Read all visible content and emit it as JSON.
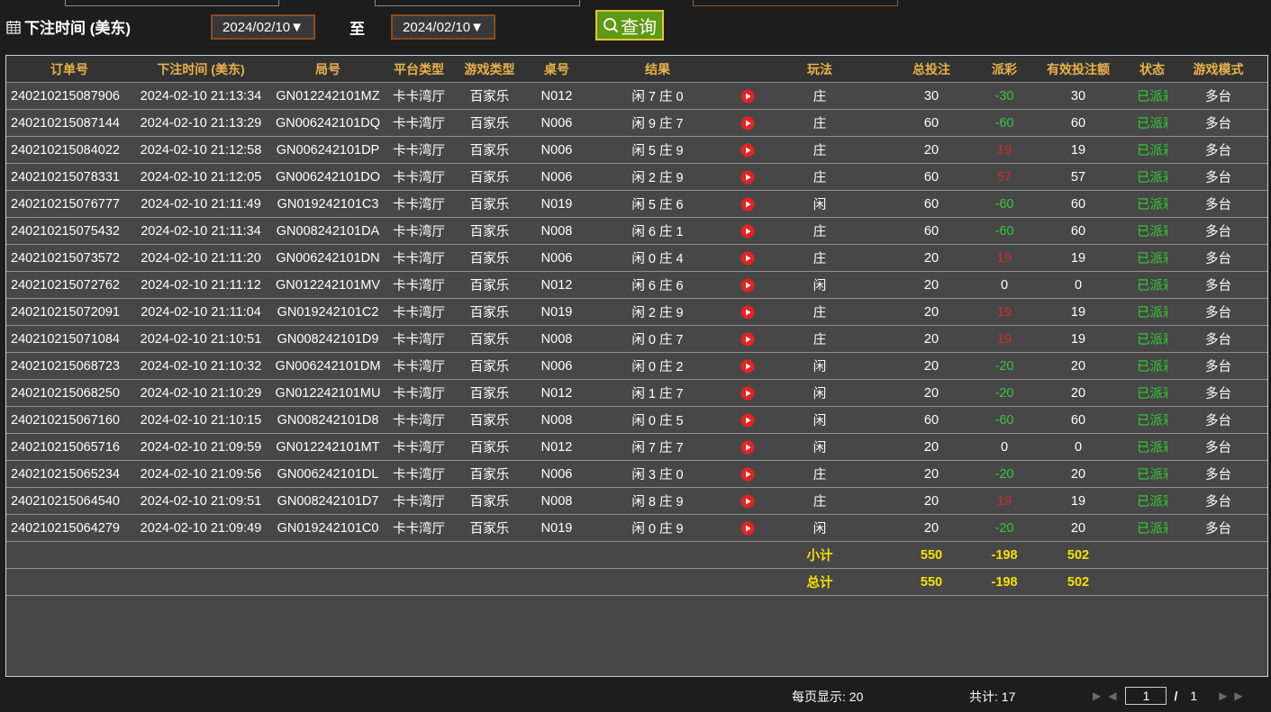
{
  "filter": {
    "date_label": "下注时间 (美东)",
    "start_date": "2024/02/10▼",
    "to_label": "至",
    "end_date": "2024/02/10▼",
    "query_label": "查询"
  },
  "table": {
    "headers": [
      "订单号",
      "下注时间 (美东)",
      "局号",
      "平台类型",
      "游戏类型",
      "桌号",
      "结果",
      "",
      "玩法",
      "总投注",
      "派彩",
      "有效投注额",
      "状态",
      "游戏模式"
    ],
    "rows": [
      {
        "order": "240210215087906",
        "time": "2024-02-10 21:13:34",
        "round": "GN012242101MZ",
        "platform": "卡卡湾厅",
        "game": "百家乐",
        "table": "N012",
        "result": "闲 7 庄 0",
        "play": "庄",
        "bet": "30",
        "payout": "-30",
        "payout_color": "green",
        "valid": "30",
        "status": "已派彩",
        "mode": "多台"
      },
      {
        "order": "240210215087144",
        "time": "2024-02-10 21:13:29",
        "round": "GN006242101DQ",
        "platform": "卡卡湾厅",
        "game": "百家乐",
        "table": "N006",
        "result": "闲 9 庄 7",
        "play": "庄",
        "bet": "60",
        "payout": "-60",
        "payout_color": "green",
        "valid": "60",
        "status": "已派彩",
        "mode": "多台"
      },
      {
        "order": "240210215084022",
        "time": "2024-02-10 21:12:58",
        "round": "GN006242101DP",
        "platform": "卡卡湾厅",
        "game": "百家乐",
        "table": "N006",
        "result": "闲 5 庄 9",
        "play": "庄",
        "bet": "20",
        "payout": "19",
        "payout_color": "red",
        "valid": "19",
        "status": "已派彩",
        "mode": "多台"
      },
      {
        "order": "240210215078331",
        "time": "2024-02-10 21:12:05",
        "round": "GN006242101DO",
        "platform": "卡卡湾厅",
        "game": "百家乐",
        "table": "N006",
        "result": "闲 2 庄 9",
        "play": "庄",
        "bet": "60",
        "payout": "57",
        "payout_color": "red",
        "valid": "57",
        "status": "已派彩",
        "mode": "多台"
      },
      {
        "order": "240210215076777",
        "time": "2024-02-10 21:11:49",
        "round": "GN019242101C3",
        "platform": "卡卡湾厅",
        "game": "百家乐",
        "table": "N019",
        "result": "闲 5 庄 6",
        "play": "闲",
        "bet": "60",
        "payout": "-60",
        "payout_color": "green",
        "valid": "60",
        "status": "已派彩",
        "mode": "多台"
      },
      {
        "order": "240210215075432",
        "time": "2024-02-10 21:11:34",
        "round": "GN008242101DA",
        "platform": "卡卡湾厅",
        "game": "百家乐",
        "table": "N008",
        "result": "闲 6 庄 1",
        "play": "庄",
        "bet": "60",
        "payout": "-60",
        "payout_color": "green",
        "valid": "60",
        "status": "已派彩",
        "mode": "多台"
      },
      {
        "order": "240210215073572",
        "time": "2024-02-10 21:11:20",
        "round": "GN006242101DN",
        "platform": "卡卡湾厅",
        "game": "百家乐",
        "table": "N006",
        "result": "闲 0 庄 4",
        "play": "庄",
        "bet": "20",
        "payout": "19",
        "payout_color": "red",
        "valid": "19",
        "status": "已派彩",
        "mode": "多台"
      },
      {
        "order": "240210215072762",
        "time": "2024-02-10 21:11:12",
        "round": "GN012242101MV",
        "platform": "卡卡湾厅",
        "game": "百家乐",
        "table": "N012",
        "result": "闲 6 庄 6",
        "play": "闲",
        "bet": "20",
        "payout": "0",
        "payout_color": "white",
        "valid": "0",
        "status": "已派彩",
        "mode": "多台"
      },
      {
        "order": "240210215072091",
        "time": "2024-02-10 21:11:04",
        "round": "GN019242101C2",
        "platform": "卡卡湾厅",
        "game": "百家乐",
        "table": "N019",
        "result": "闲 2 庄 9",
        "play": "庄",
        "bet": "20",
        "payout": "19",
        "payout_color": "red",
        "valid": "19",
        "status": "已派彩",
        "mode": "多台"
      },
      {
        "order": "240210215071084",
        "time": "2024-02-10 21:10:51",
        "round": "GN008242101D9",
        "platform": "卡卡湾厅",
        "game": "百家乐",
        "table": "N008",
        "result": "闲 0 庄 7",
        "play": "庄",
        "bet": "20",
        "payout": "19",
        "payout_color": "red",
        "valid": "19",
        "status": "已派彩",
        "mode": "多台"
      },
      {
        "order": "240210215068723",
        "time": "2024-02-10 21:10:32",
        "round": "GN006242101DM",
        "platform": "卡卡湾厅",
        "game": "百家乐",
        "table": "N006",
        "result": "闲 0 庄 2",
        "play": "闲",
        "bet": "20",
        "payout": "-20",
        "payout_color": "green",
        "valid": "20",
        "status": "已派彩",
        "mode": "多台"
      },
      {
        "order": "240210215068250",
        "time": "2024-02-10 21:10:29",
        "round": "GN012242101MU",
        "platform": "卡卡湾厅",
        "game": "百家乐",
        "table": "N012",
        "result": "闲 1 庄 7",
        "play": "闲",
        "bet": "20",
        "payout": "-20",
        "payout_color": "green",
        "valid": "20",
        "status": "已派彩",
        "mode": "多台"
      },
      {
        "order": "240210215067160",
        "time": "2024-02-10 21:10:15",
        "round": "GN008242101D8",
        "platform": "卡卡湾厅",
        "game": "百家乐",
        "table": "N008",
        "result": "闲 0 庄 5",
        "play": "闲",
        "bet": "60",
        "payout": "-60",
        "payout_color": "green",
        "valid": "60",
        "status": "已派彩",
        "mode": "多台"
      },
      {
        "order": "240210215065716",
        "time": "2024-02-10 21:09:59",
        "round": "GN012242101MT",
        "platform": "卡卡湾厅",
        "game": "百家乐",
        "table": "N012",
        "result": "闲 7 庄 7",
        "play": "闲",
        "bet": "20",
        "payout": "0",
        "payout_color": "white",
        "valid": "0",
        "status": "已派彩",
        "mode": "多台"
      },
      {
        "order": "240210215065234",
        "time": "2024-02-10 21:09:56",
        "round": "GN006242101DL",
        "platform": "卡卡湾厅",
        "game": "百家乐",
        "table": "N006",
        "result": "闲 3 庄 0",
        "play": "庄",
        "bet": "20",
        "payout": "-20",
        "payout_color": "green",
        "valid": "20",
        "status": "已派彩",
        "mode": "多台"
      },
      {
        "order": "240210215064540",
        "time": "2024-02-10 21:09:51",
        "round": "GN008242101D7",
        "platform": "卡卡湾厅",
        "game": "百家乐",
        "table": "N008",
        "result": "闲 8 庄 9",
        "play": "庄",
        "bet": "20",
        "payout": "19",
        "payout_color": "red",
        "valid": "19",
        "status": "已派彩",
        "mode": "多台"
      },
      {
        "order": "240210215064279",
        "time": "2024-02-10 21:09:49",
        "round": "GN019242101C0",
        "platform": "卡卡湾厅",
        "game": "百家乐",
        "table": "N019",
        "result": "闲 0 庄 9",
        "play": "闲",
        "bet": "20",
        "payout": "-20",
        "payout_color": "green",
        "valid": "20",
        "status": "已派彩",
        "mode": "多台"
      }
    ],
    "subtotal": {
      "label": "小计",
      "bet": "550",
      "payout": "-198",
      "valid": "502"
    },
    "total": {
      "label": "总计",
      "bet": "550",
      "payout": "-198",
      "valid": "502"
    }
  },
  "footer": {
    "per_page": "每页显示: 20",
    "total_count": "共计: 17",
    "current_page": "1",
    "separator": "/",
    "total_pages": "1"
  },
  "colors": {
    "red": "#d42a2a",
    "green": "#3ac43a",
    "status": "#2fcf2f",
    "header": "#e8b24a",
    "summary": "#f5e100"
  },
  "icons": [
    "calendar-icon",
    "search-icon",
    "play-icon",
    "first-page-icon",
    "prev-page-icon",
    "next-page-icon",
    "last-page-icon"
  ]
}
